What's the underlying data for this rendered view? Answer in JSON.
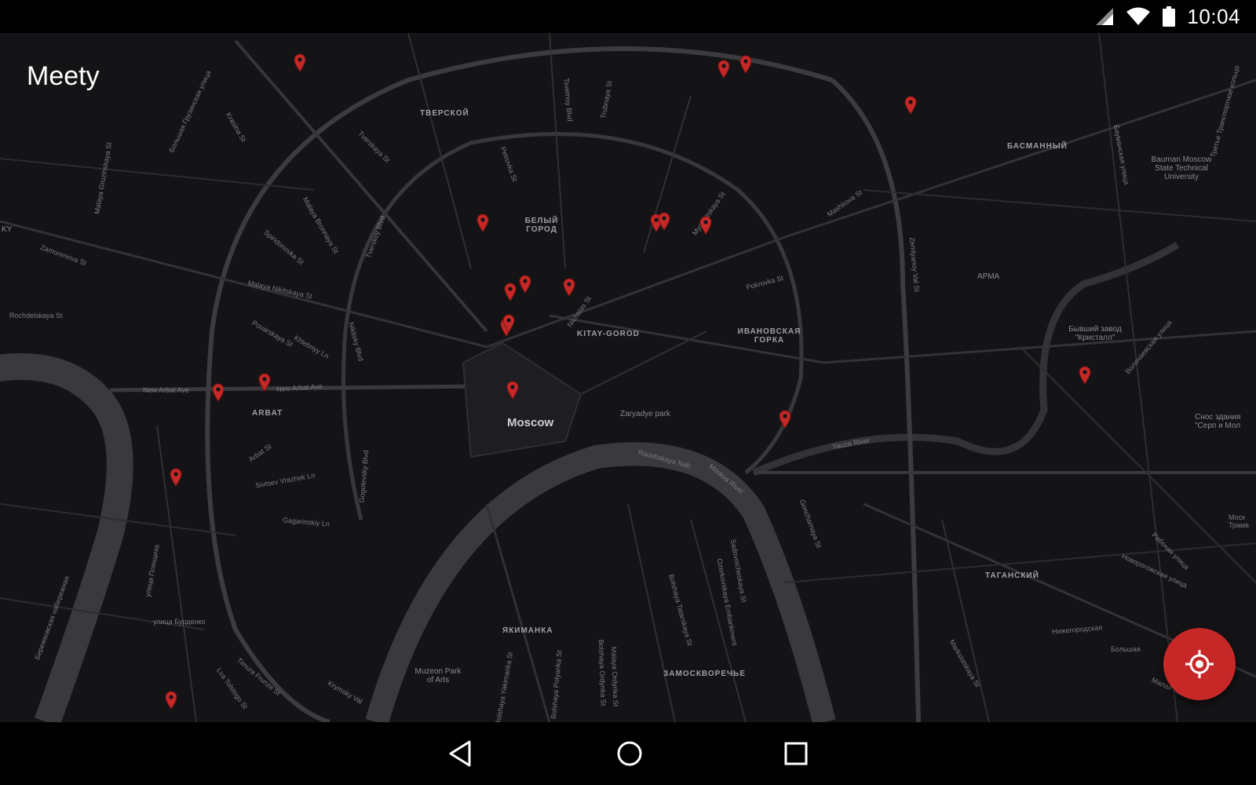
{
  "status": {
    "time": "10:04",
    "icons": [
      "signal-icon",
      "wifi-icon",
      "battery-icon"
    ]
  },
  "app": {
    "title": "Meety"
  },
  "map": {
    "city_label": "Moscow",
    "districts": [
      {
        "name": "ТВЕРСКОЙ"
      },
      {
        "name": "БЕЛЫЙ ГОРОД"
      },
      {
        "name": "KITAY-GOROD"
      },
      {
        "name": "ИВАНОВСКАЯ ГОРКА"
      },
      {
        "name": "БАСМАННЫЙ"
      },
      {
        "name": "ARBAT"
      },
      {
        "name": "ЯКИМАНКА"
      },
      {
        "name": "ЗАМОСКВОРЕЧЬЕ"
      },
      {
        "name": "ТАГАНСКИЙ"
      },
      {
        "name": "АРМА"
      }
    ],
    "places": [
      {
        "name": "Zaryadye park"
      },
      {
        "name": "Muzeon Park of Arts"
      },
      {
        "name": "Bauman Moscow State Technical University"
      },
      {
        "name": "Бывший завод \"Кристалл\""
      },
      {
        "name": "Снос здания \"Серп и Мол"
      }
    ],
    "streets": [
      {
        "name": "New Arbat Ave"
      },
      {
        "name": "Malaya Nikitskaya St"
      },
      {
        "name": "Tverskaya St"
      },
      {
        "name": "Pokrovka St"
      },
      {
        "name": "Myasnitskaya St"
      },
      {
        "name": "Nicholas St"
      },
      {
        "name": "Raushskaya Nab."
      },
      {
        "name": "Moskva River"
      },
      {
        "name": "Yauza River"
      },
      {
        "name": "Zemlyanoy Val St"
      },
      {
        "name": "Arbat St"
      },
      {
        "name": "Sivtsev Vrazhek Ln"
      },
      {
        "name": "Gagarinskiy Ln"
      },
      {
        "name": "Povarskaya St"
      },
      {
        "name": "Khlebnyy Ln"
      },
      {
        "name": "Nikitsky Blvd"
      },
      {
        "name": "Gogolevsky Blvd"
      },
      {
        "name": "Petrovka St"
      },
      {
        "name": "Tverskoy Blvd"
      },
      {
        "name": "Tsvetnoy Blvd"
      },
      {
        "name": "Trubnaya St"
      },
      {
        "name": "Rochdelskaya St"
      },
      {
        "name": "Zamorenova St"
      },
      {
        "name": "Malaya Gruzinskaya St"
      },
      {
        "name": "Spiridonovka St"
      },
      {
        "name": "Malaya Bronnaya St"
      },
      {
        "name": "Krasina St"
      },
      {
        "name": "Большая Грузинская улица"
      },
      {
        "name": "Mashkova St"
      },
      {
        "name": "Bolshaya Tatarskaya St"
      },
      {
        "name": "Ozerkovskaya Embankment"
      },
      {
        "name": "Sadovnicheskaya St"
      },
      {
        "name": "Goncharnaya St"
      },
      {
        "name": "Marksistskaya St"
      },
      {
        "name": "Bolshaya Ordynka St"
      },
      {
        "name": "Malaya Ordynka St"
      },
      {
        "name": "Bolshaya Polyanka St"
      },
      {
        "name": "Bolshaya Yakimanka St"
      },
      {
        "name": "улица Бурденко"
      },
      {
        "name": "улица Плющиха"
      },
      {
        "name": "Бережковская набережная"
      },
      {
        "name": "Timura Frunze St"
      },
      {
        "name": "Lva Tolstogo St"
      },
      {
        "name": "Krymsky Val"
      },
      {
        "name": "Бауманская улица"
      },
      {
        "name": "Третье Транспортное кольцо"
      },
      {
        "name": "Волочаевская улица"
      },
      {
        "name": "Рабочая улица"
      },
      {
        "name": "Новорогожская улица"
      },
      {
        "name": "Нижегородская"
      },
      {
        "name": "Большая"
      },
      {
        "name": "Малая Калит"
      },
      {
        "name": "Моск Трамв"
      },
      {
        "name": "KY"
      }
    ],
    "pins_count": 22
  },
  "fab": {
    "label": "my-location"
  },
  "nav": {
    "buttons": [
      "back",
      "home",
      "recents"
    ]
  },
  "colors": {
    "accent": "#c62828",
    "map_bg": "#141416",
    "road": "#3a3a3e",
    "river": "#3c3c40"
  }
}
